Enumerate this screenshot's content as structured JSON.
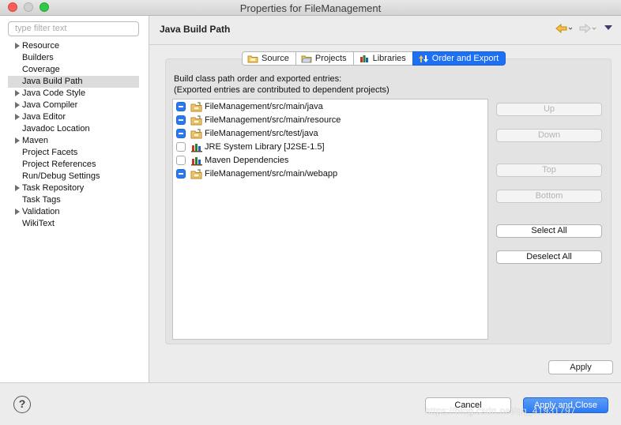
{
  "window": {
    "title": "Properties for FileManagement"
  },
  "sidebar": {
    "filter_placeholder": "type filter text",
    "items": [
      {
        "label": "Resource",
        "expandable": true
      },
      {
        "label": "Builders",
        "expandable": false
      },
      {
        "label": "Coverage",
        "expandable": false
      },
      {
        "label": "Java Build Path",
        "expandable": false,
        "selected": true
      },
      {
        "label": "Java Code Style",
        "expandable": true
      },
      {
        "label": "Java Compiler",
        "expandable": true
      },
      {
        "label": "Java Editor",
        "expandable": true
      },
      {
        "label": "Javadoc Location",
        "expandable": false
      },
      {
        "label": "Maven",
        "expandable": true
      },
      {
        "label": "Project Facets",
        "expandable": false
      },
      {
        "label": "Project References",
        "expandable": false
      },
      {
        "label": "Run/Debug Settings",
        "expandable": false
      },
      {
        "label": "Task Repository",
        "expandable": true
      },
      {
        "label": "Task Tags",
        "expandable": false
      },
      {
        "label": "Validation",
        "expandable": true
      },
      {
        "label": "WikiText",
        "expandable": false
      }
    ]
  },
  "page": {
    "title": "Java Build Path",
    "tabs": [
      {
        "label": "Source",
        "icon": "source-folder-icon"
      },
      {
        "label": "Projects",
        "icon": "projects-folder-icon"
      },
      {
        "label": "Libraries",
        "icon": "libraries-icon"
      },
      {
        "label": "Order and Export",
        "icon": "order-export-icon",
        "active": true
      }
    ],
    "description_line1": "Build class path order and exported entries:",
    "description_line2": "(Exported entries are contributed to dependent projects)",
    "entries": [
      {
        "label": "FileManagement/src/main/java",
        "checked": true,
        "icon": "source-folder-icon"
      },
      {
        "label": "FileManagement/src/main/resource",
        "checked": true,
        "icon": "source-folder-icon"
      },
      {
        "label": "FileManagement/src/test/java",
        "checked": true,
        "icon": "source-folder-icon"
      },
      {
        "label": "JRE System Library [J2SE-1.5]",
        "checked": false,
        "icon": "library-icon"
      },
      {
        "label": "Maven Dependencies",
        "checked": false,
        "icon": "library-icon"
      },
      {
        "label": "FileManagement/src/main/webapp",
        "checked": true,
        "icon": "source-folder-icon"
      }
    ],
    "buttons": {
      "up": "Up",
      "down": "Down",
      "top": "Top",
      "bottom": "Bottom",
      "select_all": "Select All",
      "deselect_all": "Deselect All"
    },
    "apply": "Apply"
  },
  "footer": {
    "help": "?",
    "cancel": "Cancel",
    "apply_and_close": "Apply and Close",
    "watermark": "https://blog.csdn.net/qq_41931797"
  },
  "colors": {
    "accent": "#1d6ff3",
    "checkbox_on": "#2a79f3",
    "nav_back": "#e6a31c"
  }
}
